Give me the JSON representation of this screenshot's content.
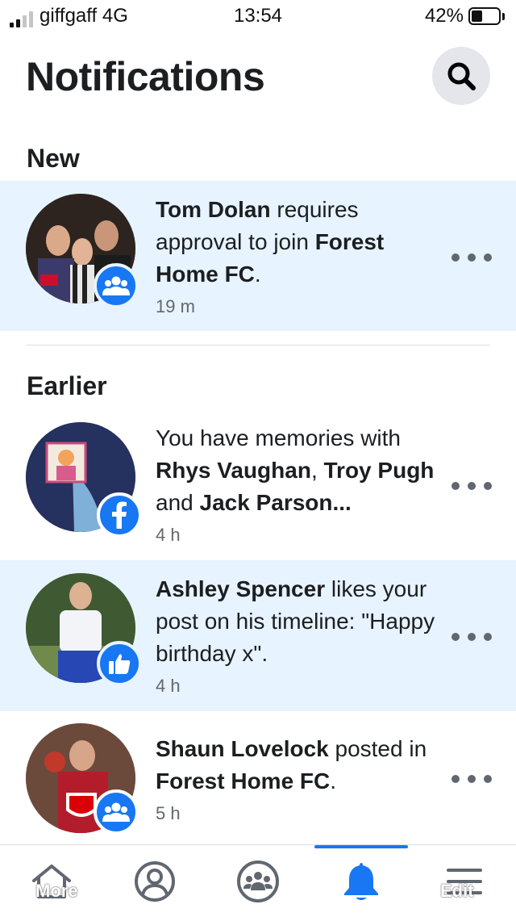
{
  "status_bar": {
    "carrier": "giffgaff 4G",
    "time": "13:54",
    "battery_percent": "42%",
    "battery_level": 0.42,
    "signal_bars_active": 2,
    "signal_bars_total": 4
  },
  "header": {
    "title": "Notifications",
    "search_icon": "search-icon"
  },
  "sections": {
    "new_label": "New",
    "earlier_label": "Earlier"
  },
  "notifications": [
    {
      "state": "unread",
      "parts": [
        {
          "text": "Tom Dolan",
          "bold": true
        },
        {
          "text": " requires approval to join ",
          "bold": false
        },
        {
          "text": "Forest Home FC",
          "bold": true
        },
        {
          "text": ".",
          "bold": false
        }
      ],
      "time": "19 m",
      "badge_icon": "group-icon"
    },
    {
      "state": "read",
      "parts": [
        {
          "text": "You have memories with ",
          "bold": false
        },
        {
          "text": "Rhys Vaughan",
          "bold": true
        },
        {
          "text": ", ",
          "bold": false
        },
        {
          "text": "Troy Pugh",
          "bold": true
        },
        {
          "text": " and ",
          "bold": false
        },
        {
          "text": "Jack Parson...",
          "bold": true
        }
      ],
      "time": "4 h",
      "badge_icon": "facebook-icon"
    },
    {
      "state": "unread",
      "parts": [
        {
          "text": "Ashley Spencer",
          "bold": true
        },
        {
          "text": " likes your post on his timeline: \"Happy birthday x\".",
          "bold": false
        }
      ],
      "time": "4 h",
      "badge_icon": "like-icon"
    },
    {
      "state": "read",
      "parts": [
        {
          "text": "Shaun Lovelock",
          "bold": true
        },
        {
          "text": " posted in ",
          "bold": false
        },
        {
          "text": "Forest Home FC",
          "bold": true
        },
        {
          "text": ".",
          "bold": false
        }
      ],
      "time": "5 h",
      "badge_icon": "group-icon"
    }
  ],
  "tab_bar": {
    "tabs": [
      {
        "name": "home-icon"
      },
      {
        "name": "profile-icon"
      },
      {
        "name": "groups-icon"
      },
      {
        "name": "notifications-bell-icon",
        "active": true
      },
      {
        "name": "menu-icon"
      }
    ],
    "overlay_left": "More",
    "overlay_right": "Edit"
  },
  "colors": {
    "accent": "#1877f2",
    "unread_bg": "#e7f3ff",
    "secondary_text": "#65676b"
  }
}
